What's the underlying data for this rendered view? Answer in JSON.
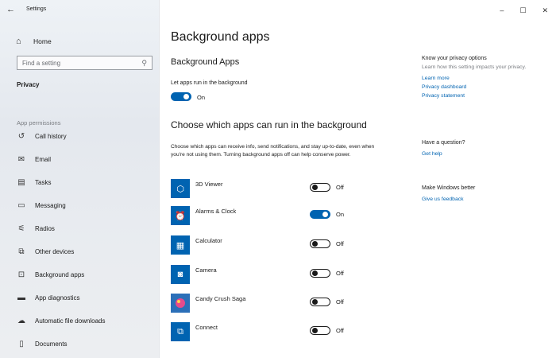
{
  "window": {
    "title": "Settings",
    "controls": [
      "–",
      "☐",
      "✕"
    ]
  },
  "sidebar": {
    "home_label": "Home",
    "search_placeholder": "Find a setting",
    "section_privacy": "Privacy",
    "section_permissions": "App permissions",
    "items": [
      {
        "label": "Call history",
        "icon": "call-history-icon"
      },
      {
        "label": "Email",
        "icon": "email-icon"
      },
      {
        "label": "Tasks",
        "icon": "tasks-icon"
      },
      {
        "label": "Messaging",
        "icon": "messaging-icon"
      },
      {
        "label": "Radios",
        "icon": "radios-icon"
      },
      {
        "label": "Other devices",
        "icon": "other-devices-icon"
      },
      {
        "label": "Background apps",
        "icon": "background-apps-icon"
      },
      {
        "label": "App diagnostics",
        "icon": "app-diagnostics-icon"
      },
      {
        "label": "Automatic file downloads",
        "icon": "cloud-icon"
      },
      {
        "label": "Documents",
        "icon": "document-icon"
      }
    ]
  },
  "main": {
    "page_title": "Background apps",
    "section1_title": "Background Apps",
    "let_apps_label": "Let apps run in the background",
    "master_toggle_state": "On",
    "section2_title": "Choose which apps can run in the background",
    "description": "Choose which apps can receive info, send notifications, and stay up-to-date, even when you're not using them. Turning background apps off can help conserve power.",
    "apps": [
      {
        "name": "3D Viewer",
        "state": "Off",
        "color": "#0063b1",
        "icon": "cube-icon"
      },
      {
        "name": "Alarms & Clock",
        "state": "On",
        "color": "#0063b1",
        "icon": "alarm-clock-icon"
      },
      {
        "name": "Calculator",
        "state": "Off",
        "color": "#0063b1",
        "icon": "calculator-icon"
      },
      {
        "name": "Camera",
        "state": "Off",
        "color": "#0063b1",
        "icon": "camera-icon"
      },
      {
        "name": "Candy Crush Saga",
        "state": "Off",
        "color": "#2b6fb8",
        "icon": "candy-icon"
      },
      {
        "name": "Connect",
        "state": "Off",
        "color": "#0063b1",
        "icon": "connect-icon"
      }
    ]
  },
  "right": {
    "privacy_head": "Know your privacy options",
    "privacy_text": "Learn how this setting impacts your privacy.",
    "links": [
      "Learn more",
      "Privacy dashboard",
      "Privacy statement"
    ],
    "question_head": "Have a question?",
    "get_help": "Get help",
    "better_head": "Make Windows better",
    "feedback": "Give us feedback"
  },
  "colors": {
    "accent": "#0063b1",
    "sidebar_bg": "#e9ecf0"
  }
}
